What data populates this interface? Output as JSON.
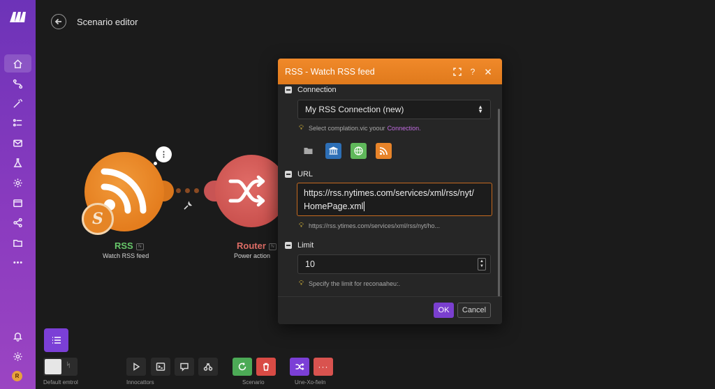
{
  "header": {
    "title": "Scenario editor"
  },
  "sidebar": {
    "items": [
      {
        "icon": "home-icon",
        "active": true
      },
      {
        "icon": "route-icon"
      },
      {
        "icon": "wand-icon"
      },
      {
        "icon": "list-icon"
      },
      {
        "icon": "mail-icon"
      },
      {
        "icon": "flask-icon"
      },
      {
        "icon": "gear-icon"
      },
      {
        "icon": "window-icon"
      },
      {
        "icon": "share-icon"
      },
      {
        "icon": "folder-icon"
      },
      {
        "icon": "more-icon"
      }
    ],
    "bottom": [
      {
        "icon": "bell-icon"
      },
      {
        "icon": "settings-icon"
      }
    ],
    "avatar_initial": "R"
  },
  "canvas": {
    "rss_module": {
      "name": "RSS",
      "subtitle": "Watch RSS feed",
      "badge_glyph": "S",
      "bubble": "⋮",
      "tag": "ℕ"
    },
    "router_module": {
      "name": "Router",
      "subtitle": "Power action",
      "tag": "ℕ"
    }
  },
  "dialog": {
    "title": "RSS - Watch RSS feed",
    "connection": {
      "label": "Connection",
      "value": "My RSS Connection (new)",
      "hint": "Select complation.vic yoour",
      "hint_link": "Connection."
    },
    "url": {
      "label": "URL",
      "value_line1": "https://rss.nytimes.com/services/xml/rss/nyt/",
      "value_line2": "HomePage.xml",
      "hint": "https://rss.ytimes.com/services/xml/rss/nyt/ho..."
    },
    "limit": {
      "label": "Limit",
      "value": "10",
      "hint": "Specify the limit for reconaaheu:."
    },
    "ok_label": "OK",
    "cancel_label": "Cancel"
  },
  "toolbar": {
    "toggle_side": "ᛋ",
    "labels": {
      "default": "Default emtrol",
      "innocations": "Innocattors",
      "scenario": "Scenario",
      "une": "Une-Xo-fieln"
    }
  },
  "colors": {
    "sidebar": "#7a38ba",
    "rss": "#e8842a",
    "router": "#d45c58",
    "dialog_header": "#e8821f",
    "accent": "#7b3fd6"
  }
}
